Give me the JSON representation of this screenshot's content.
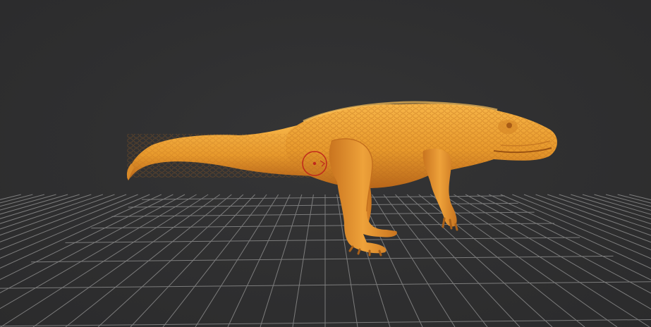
{
  "viewport": {
    "background_color": "#2f2f30",
    "grid_color": "#8a8a8a",
    "model_color": "#e89a2c",
    "model_shadow_color": "#b8661a",
    "model_highlight_color": "#f7b548",
    "brush_cursor_color": "#c0281c",
    "model_name": "",
    "icons": [
      "brush-cursor-icon"
    ]
  }
}
